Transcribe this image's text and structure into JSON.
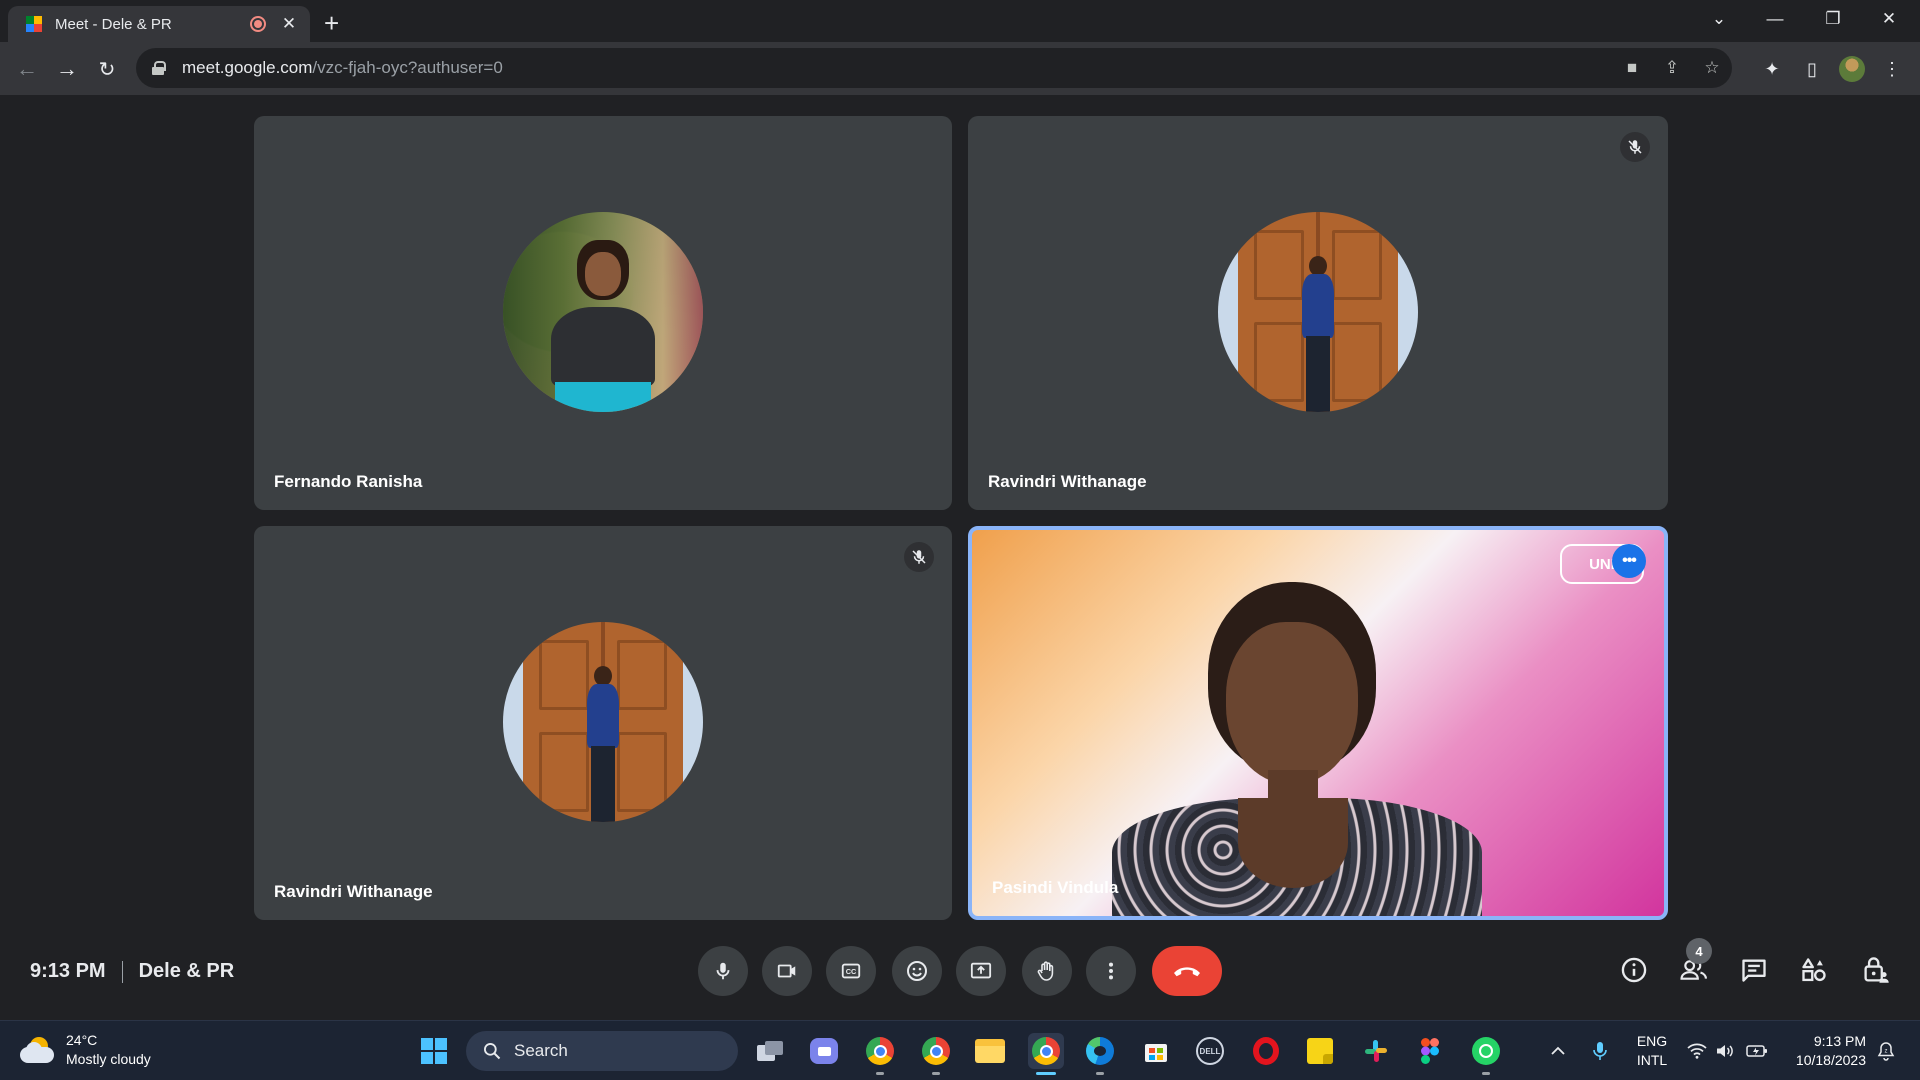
{
  "browser": {
    "tab_title": "Meet - Dele & PR",
    "url_host": "meet.google.com",
    "url_path": "/vzc-fjah-oyc?authuser=0"
  },
  "participants": [
    {
      "name": "Fernando Ranisha",
      "muted": false
    },
    {
      "name": "Ravindri Withanage",
      "muted": true
    },
    {
      "name": "Ravindri Withanage",
      "muted": true
    },
    {
      "name": "Pasindi Vindula",
      "muted": false,
      "speaking": true
    }
  ],
  "meeting": {
    "time": "9:13 PM",
    "name": "Dele & PR",
    "participant_count": "4"
  },
  "taskbar": {
    "weather_temp": "24°C",
    "weather_desc": "Mostly cloudy",
    "search_label": "Search",
    "lang_top": "ENG",
    "lang_bottom": "INTL",
    "clock_time": "9:13 PM",
    "clock_date": "10/18/2023"
  },
  "colors": {
    "end_call": "#ea4335",
    "active_speaker_border": "#8ab4f8",
    "tile_bg": "#3c4043"
  }
}
